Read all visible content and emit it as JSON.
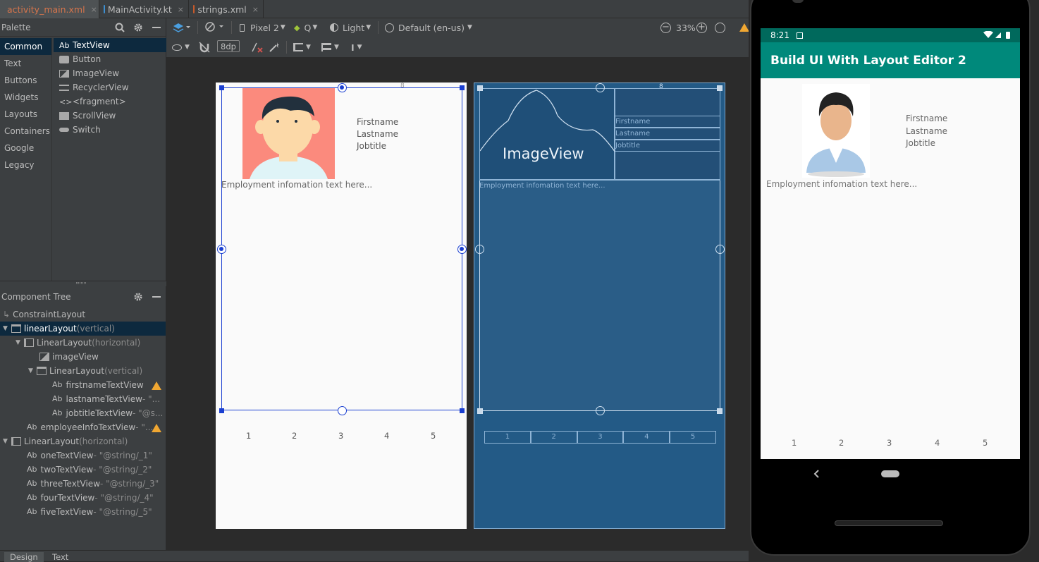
{
  "tabs": [
    {
      "label": "activity_main.xml",
      "close": "×"
    },
    {
      "label": "MainActivity.kt",
      "close": "×"
    },
    {
      "label": "strings.xml",
      "close": "×"
    }
  ],
  "palette": {
    "title": "Palette",
    "categories": [
      "Common",
      "Text",
      "Buttons",
      "Widgets",
      "Layouts",
      "Containers",
      "Google",
      "Legacy"
    ],
    "items": [
      {
        "icon": "Ab",
        "label": "TextView"
      },
      {
        "icon": "button-icon",
        "label": "Button"
      },
      {
        "icon": "image-icon",
        "label": "ImageView"
      },
      {
        "icon": "list-icon",
        "label": "RecyclerView"
      },
      {
        "icon": "<>",
        "label": "<fragment>"
      },
      {
        "icon": "scroll-icon",
        "label": "ScrollView"
      },
      {
        "icon": "switch-icon",
        "label": "Switch"
      }
    ]
  },
  "toolbar": {
    "device": "Pixel 2",
    "api": "Q",
    "theme": "Light",
    "locale": "Default (en-us)",
    "zoom": "33%",
    "margin": "8dp"
  },
  "tree": {
    "title": "Component Tree",
    "rows": [
      {
        "name": "ConstraintLayout",
        "suffix": ""
      },
      {
        "name": "linearLayout",
        "suffix": "(vertical)"
      },
      {
        "name": "LinearLayout",
        "suffix": "(horizontal)"
      },
      {
        "name": "imageView",
        "suffix": ""
      },
      {
        "name": "LinearLayout",
        "suffix": "(vertical)"
      },
      {
        "name": "firstnameTextView",
        "suffix": ""
      },
      {
        "name": "lastnameTextView",
        "suffix": "- \"..."
      },
      {
        "name": "jobtitleTextView",
        "suffix": "- \"@s..."
      },
      {
        "name": "employeeInfoTextView",
        "suffix": "- \"..."
      },
      {
        "name": "LinearLayout",
        "suffix": "(horizontal)"
      },
      {
        "name": "oneTextView",
        "suffix": "- \"@string/_1\""
      },
      {
        "name": "twoTextView",
        "suffix": "- \"@string/_2\""
      },
      {
        "name": "threeTextView",
        "suffix": "- \"@string/_3\""
      },
      {
        "name": "fourTextView",
        "suffix": "- \"@string/_4\""
      },
      {
        "name": "fiveTextView",
        "suffix": "- \"@string/_5\""
      }
    ]
  },
  "layout": {
    "firstname": "Firstname",
    "lastname": "Lastname",
    "jobtitle": "Jobtitle",
    "info": "Employment infomation text here...",
    "numbers": [
      "1",
      "2",
      "3",
      "4",
      "5"
    ],
    "imageview_label": "ImageView",
    "margin_marker": "8"
  },
  "device": {
    "time": "8:21",
    "app_title": "Build UI With Layout Editor 2"
  },
  "bottom_tabs": [
    "Design",
    "Text"
  ],
  "colors": {
    "accent": "#00897b",
    "statusbar": "#00695c",
    "selection": "#0d293e",
    "warning": "#f0a732",
    "blueprint": "#235a86"
  }
}
